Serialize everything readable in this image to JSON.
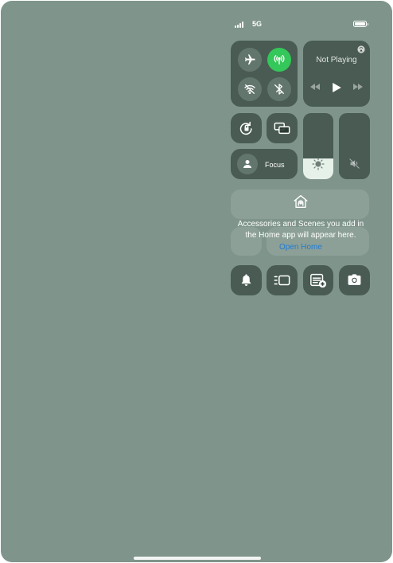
{
  "status_bar": {
    "network": "5G",
    "signal_icon": "signal-bars-icon",
    "battery_icon": "battery-icon"
  },
  "connectivity": {
    "airplane": {
      "icon": "airplane-icon",
      "on": false
    },
    "cellular": {
      "icon": "cellular-antenna-icon",
      "on": true,
      "color": "#34c759"
    },
    "wifi": {
      "icon": "wifi-off-icon",
      "on": false
    },
    "bluetooth": {
      "icon": "bluetooth-off-icon",
      "on": false
    }
  },
  "now_playing": {
    "title": "Not Playing",
    "airplay_icon": "airplay-icon",
    "controls": [
      "rewind-icon",
      "play-icon",
      "fast-forward-icon"
    ]
  },
  "tiles": {
    "orientation_lock_icon": "orientation-lock-icon",
    "screen_mirroring_icon": "screen-mirroring-icon",
    "focus_label": "Focus",
    "focus_icon": "person-icon"
  },
  "sliders": {
    "brightness": {
      "level": 0.31,
      "icon": "sun-icon"
    },
    "volume": {
      "level": 0.0,
      "icon": "speaker-muted-icon"
    }
  },
  "home": {
    "icon": "home-icon",
    "message": "Accessories and Scenes you add in the Home app will appear here.",
    "link": "Open Home"
  },
  "bottom_row": [
    "bell-icon",
    "stage-manager-icon",
    "notes-add-icon",
    "camera-icon"
  ],
  "colors": {
    "accent_green": "#34c759",
    "link_blue": "#1f7cd6",
    "background": "#7f958b"
  }
}
